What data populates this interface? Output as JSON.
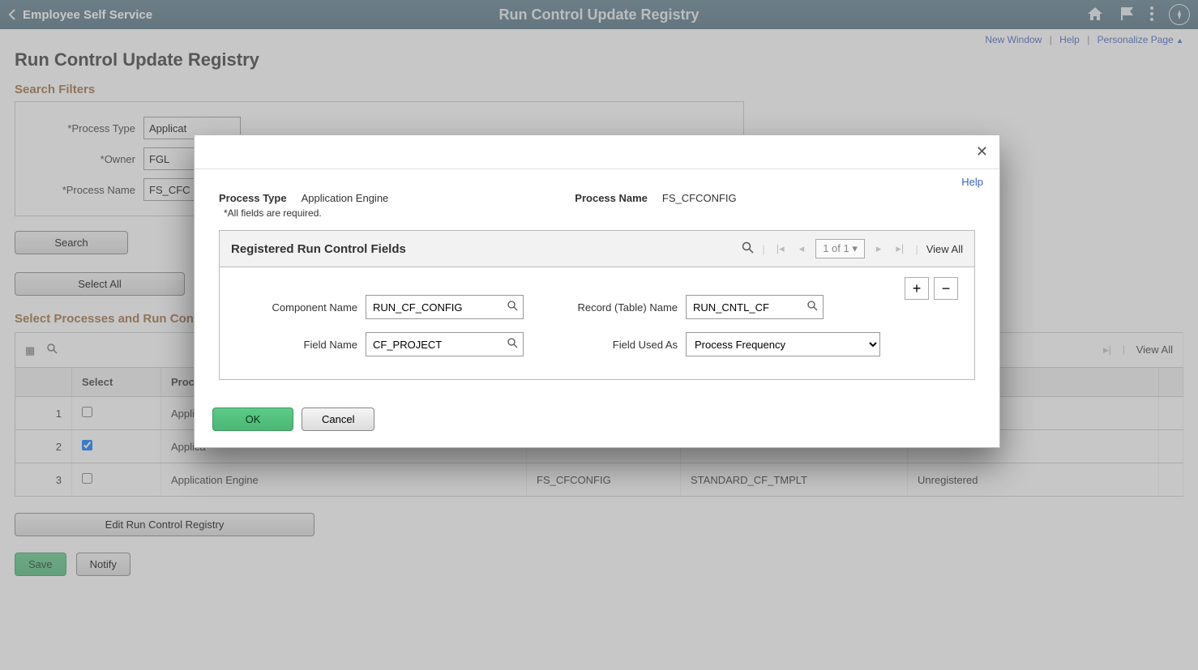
{
  "topbar": {
    "back_label": "Employee Self Service",
    "title": "Run Control Update Registry"
  },
  "util_links": {
    "new_window": "New Window",
    "help": "Help",
    "personalize": "Personalize Page"
  },
  "page": {
    "title": "Run Control Update Registry",
    "search_filters_heading": "Search Filters",
    "filters": {
      "process_type_label": "*Process Type",
      "process_type_value": "Applicat",
      "owner_label": "*Owner",
      "owner_value": "FGL",
      "process_name_label": "*Process Name",
      "process_name_value": "FS_CFC"
    },
    "search_btn": "Search",
    "select_all_btn": "Select All",
    "section2": "Select Processes and Run Con",
    "view_all": "View All"
  },
  "table": {
    "headers": {
      "select": "Select",
      "process": "Proces"
    },
    "rows": [
      {
        "num": "1",
        "select": false,
        "proc": "Applica"
      },
      {
        "num": "2",
        "select": true,
        "proc": "Applica"
      },
      {
        "num": "3",
        "select": false,
        "proc": "Application Engine",
        "c2": "FS_CFCONFIG",
        "c3": "STANDARD_CF_TMPLT",
        "c4": "Unregistered"
      }
    ]
  },
  "edit_btn": "Edit Run Control Registry",
  "save_btn": "Save",
  "notify_btn": "Notify",
  "modal": {
    "help": "Help",
    "process_type_label": "Process Type",
    "process_type_value": "Application Engine",
    "process_name_label": "Process Name",
    "process_name_value": "FS_CFCONFIG",
    "required_note": "*All fields are required.",
    "grid_title": "Registered Run Control Fields",
    "counter": "1 of 1",
    "view_all": "View All",
    "component_name_label": "Component Name",
    "component_name_value": "RUN_CF_CONFIG",
    "record_name_label": "Record (Table) Name",
    "record_name_value": "RUN_CNTL_CF",
    "field_name_label": "Field Name",
    "field_name_value": "CF_PROJECT",
    "field_used_as_label": "Field Used As",
    "field_used_as_value": "Process Frequency",
    "ok": "OK",
    "cancel": "Cancel"
  }
}
